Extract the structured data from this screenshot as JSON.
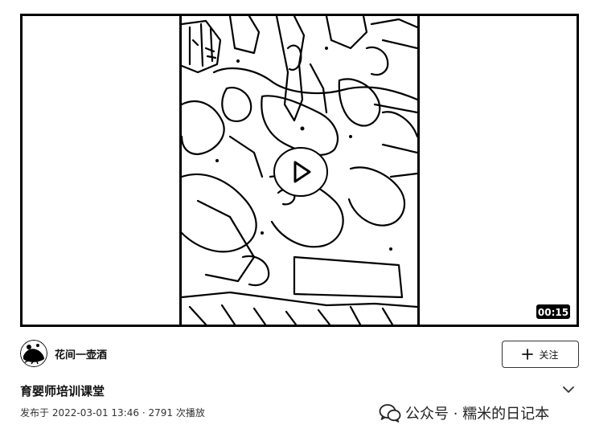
{
  "video": {
    "duration": "00:15",
    "play_icon": "play-icon"
  },
  "author": {
    "name": "花间一壶酒",
    "avatar_icon": "avatar-image"
  },
  "follow": {
    "label": "关注",
    "icon": "plus-icon"
  },
  "title": "育婴师培训课堂",
  "meta": {
    "published_prefix": "发布于",
    "published_at": "2022-03-01 13:46",
    "separator": "·",
    "plays": "2791 次播放"
  },
  "watermark": {
    "text": "公众号 · 糯米的日记本",
    "icon": "wechat-icon"
  },
  "colors": {
    "background": "#ffffff",
    "frame": "#000000",
    "text": "#111111"
  }
}
